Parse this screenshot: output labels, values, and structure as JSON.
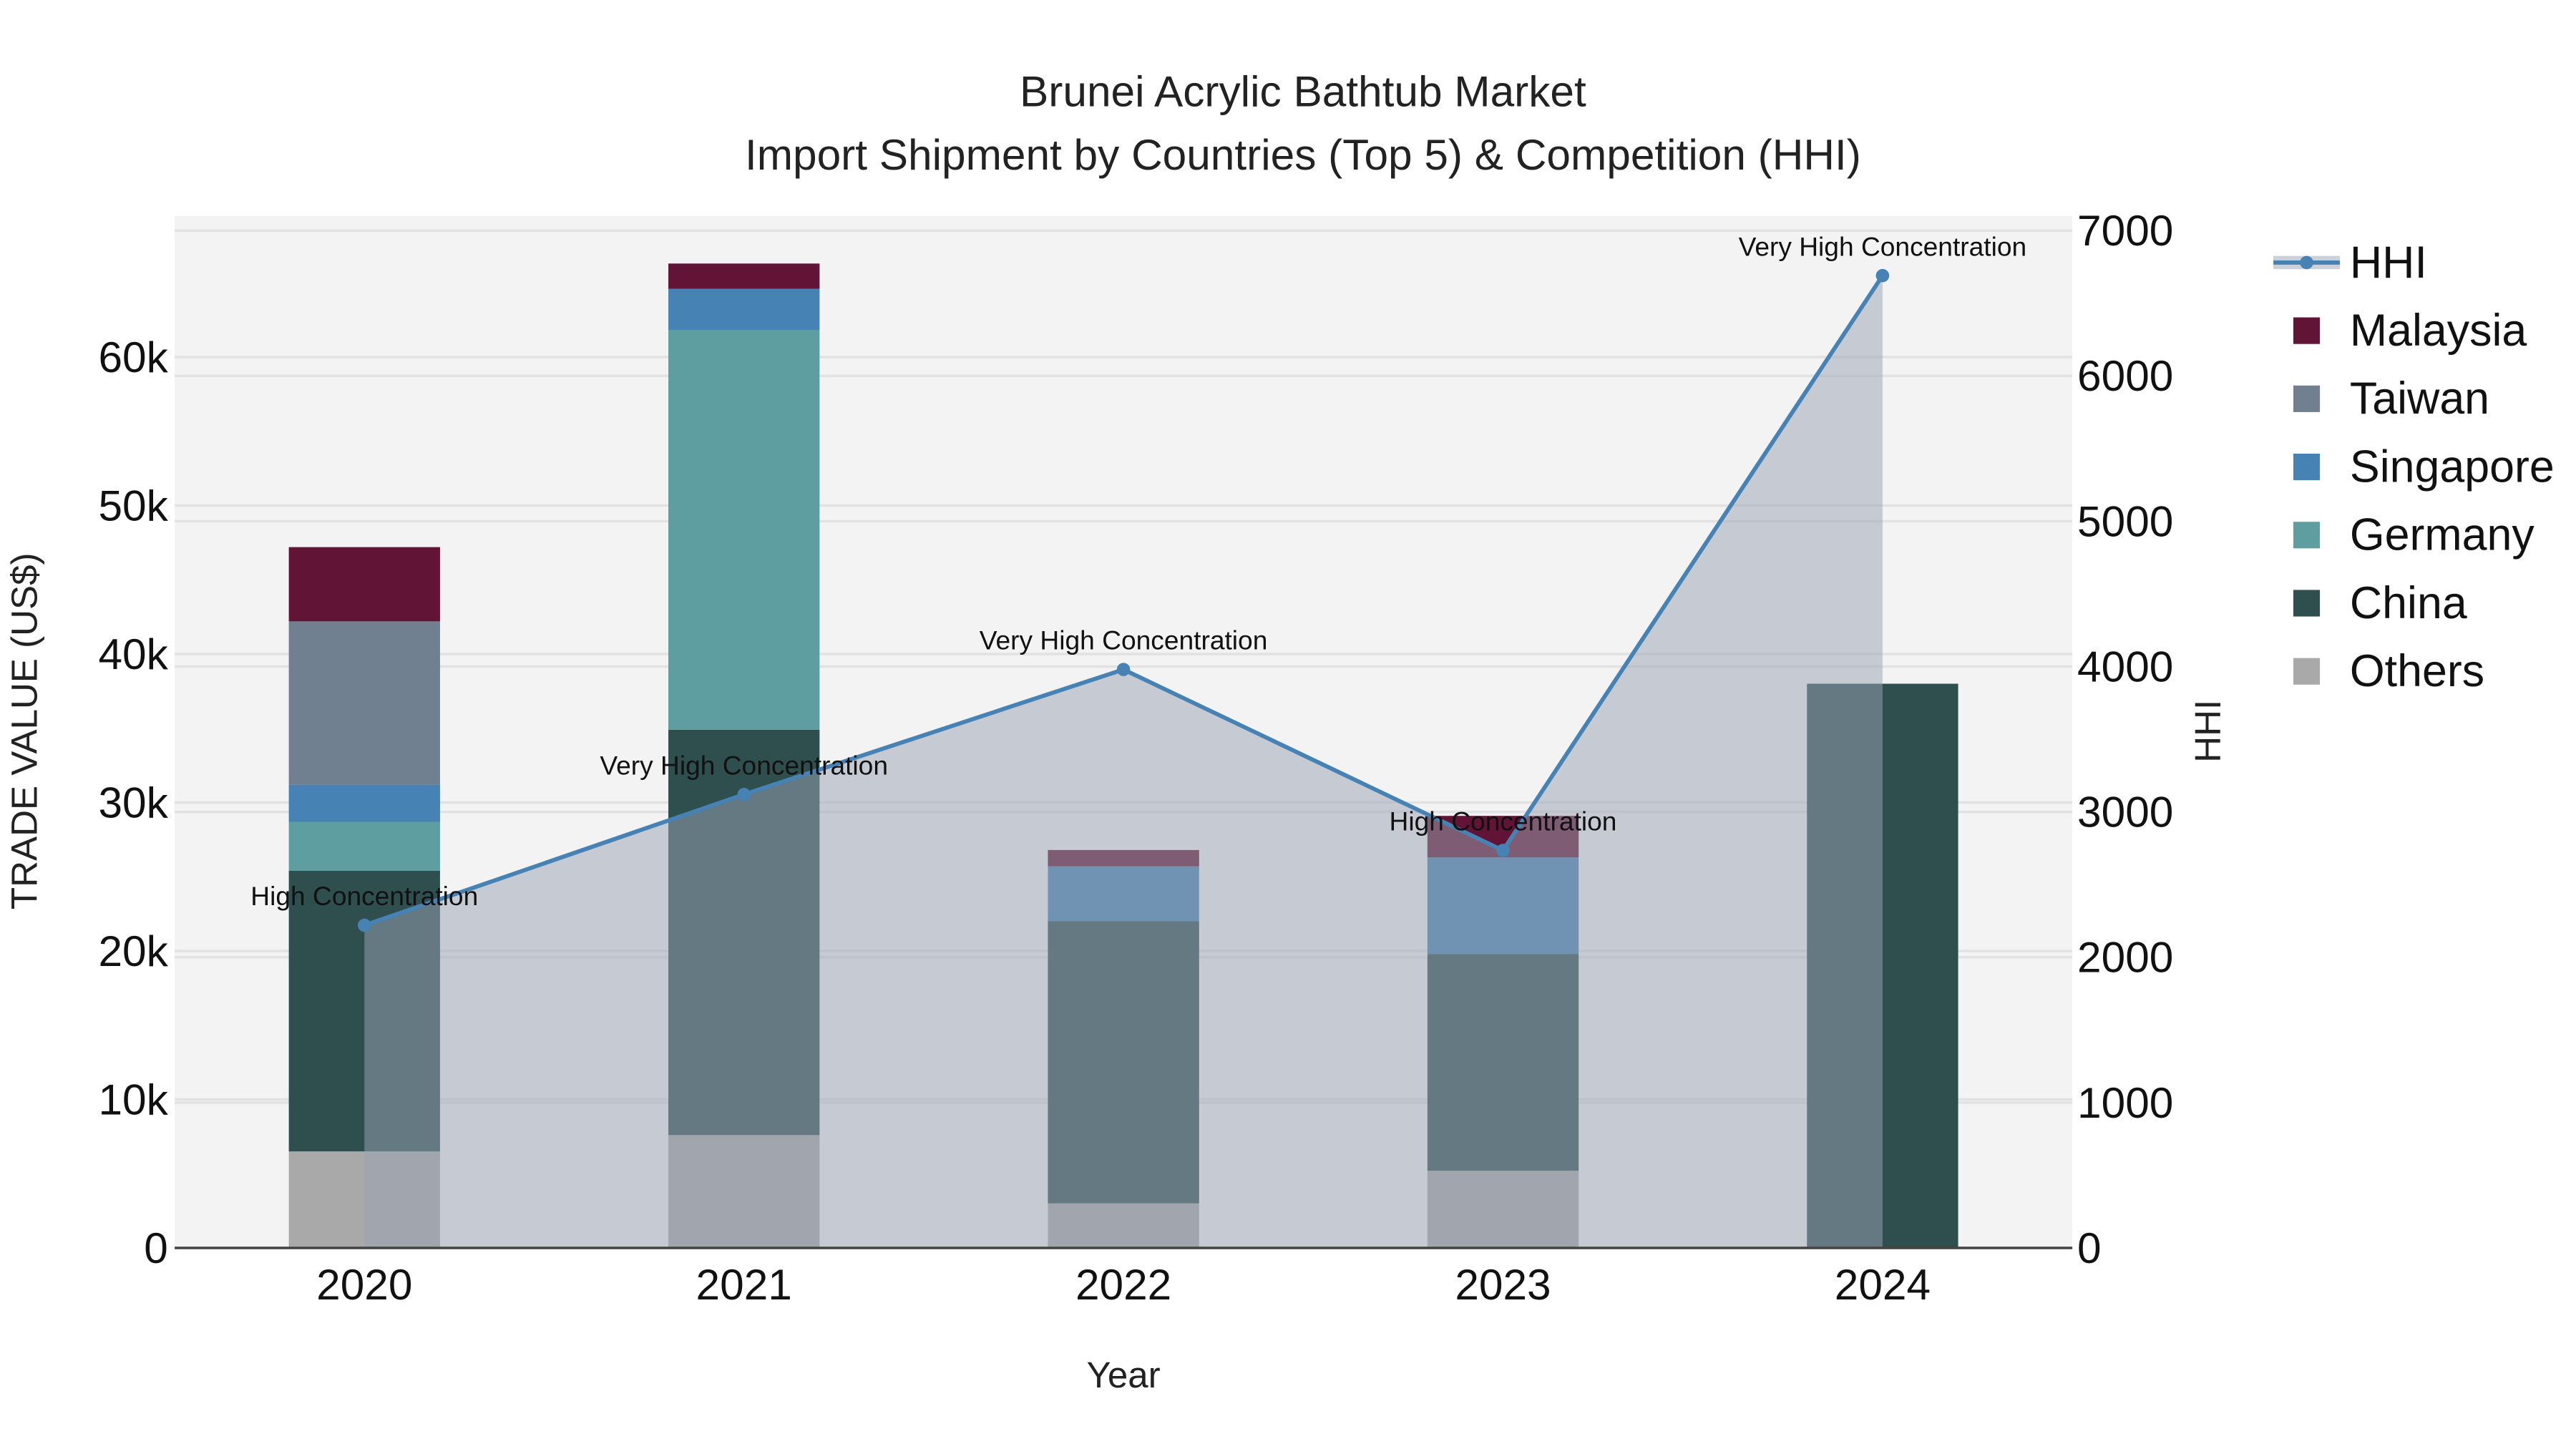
{
  "chart_data": {
    "type": "bar",
    "title": "Brunei Acrylic Bathtub Market",
    "subtitle": "Import Shipment by Countries (Top 5) & Competition (HHI)",
    "xlabel": "Year",
    "ylabel": "TRADE VALUE (US$)",
    "y2label": "HHI",
    "categories": [
      "2020",
      "2021",
      "2022",
      "2023",
      "2024"
    ],
    "ylim": [
      0,
      69500
    ],
    "y2lim": [
      0,
      7100
    ],
    "yticks": [
      0,
      10000,
      20000,
      30000,
      40000,
      50000,
      60000
    ],
    "ytick_labels": [
      "0",
      "10k",
      "20k",
      "30k",
      "40k",
      "50k",
      "60k"
    ],
    "y2ticks": [
      0,
      1000,
      2000,
      3000,
      4000,
      5000,
      6000,
      7000
    ],
    "y2tick_labels": [
      "0",
      "1000",
      "2000",
      "3000",
      "4000",
      "5000",
      "6000",
      "7000"
    ],
    "series": [
      {
        "name": "Others",
        "color": "#a9a9a9",
        "values": [
          6500,
          7600,
          3000,
          5200,
          0
        ]
      },
      {
        "name": "China",
        "color": "#2f4f4f",
        "values": [
          18900,
          27300,
          19000,
          14600,
          38000
        ]
      },
      {
        "name": "Germany",
        "color": "#5f9ea0",
        "values": [
          3300,
          26900,
          0,
          0,
          0
        ]
      },
      {
        "name": "Singapore",
        "color": "#4682b4",
        "values": [
          2500,
          2800,
          3700,
          6500,
          0
        ]
      },
      {
        "name": "Taiwan",
        "color": "#708090",
        "values": [
          11000,
          0,
          0,
          0,
          0
        ]
      },
      {
        "name": "Malaysia",
        "color": "#611435",
        "values": [
          5000,
          1700,
          1100,
          2800,
          0
        ]
      }
    ],
    "hhi": {
      "name": "HHI",
      "color": "#4682b4",
      "values": [
        2220,
        3120,
        3980,
        2735,
        6690
      ],
      "annotations": [
        "High Concentration",
        "Very High Concentration",
        "Very High Concentration",
        "High Concentration",
        "Very High Concentration"
      ]
    },
    "legend": [
      "HHI",
      "Malaysia",
      "Taiwan",
      "Singapore",
      "Germany",
      "China",
      "Others"
    ],
    "legend_placement": "right",
    "grid": true
  }
}
